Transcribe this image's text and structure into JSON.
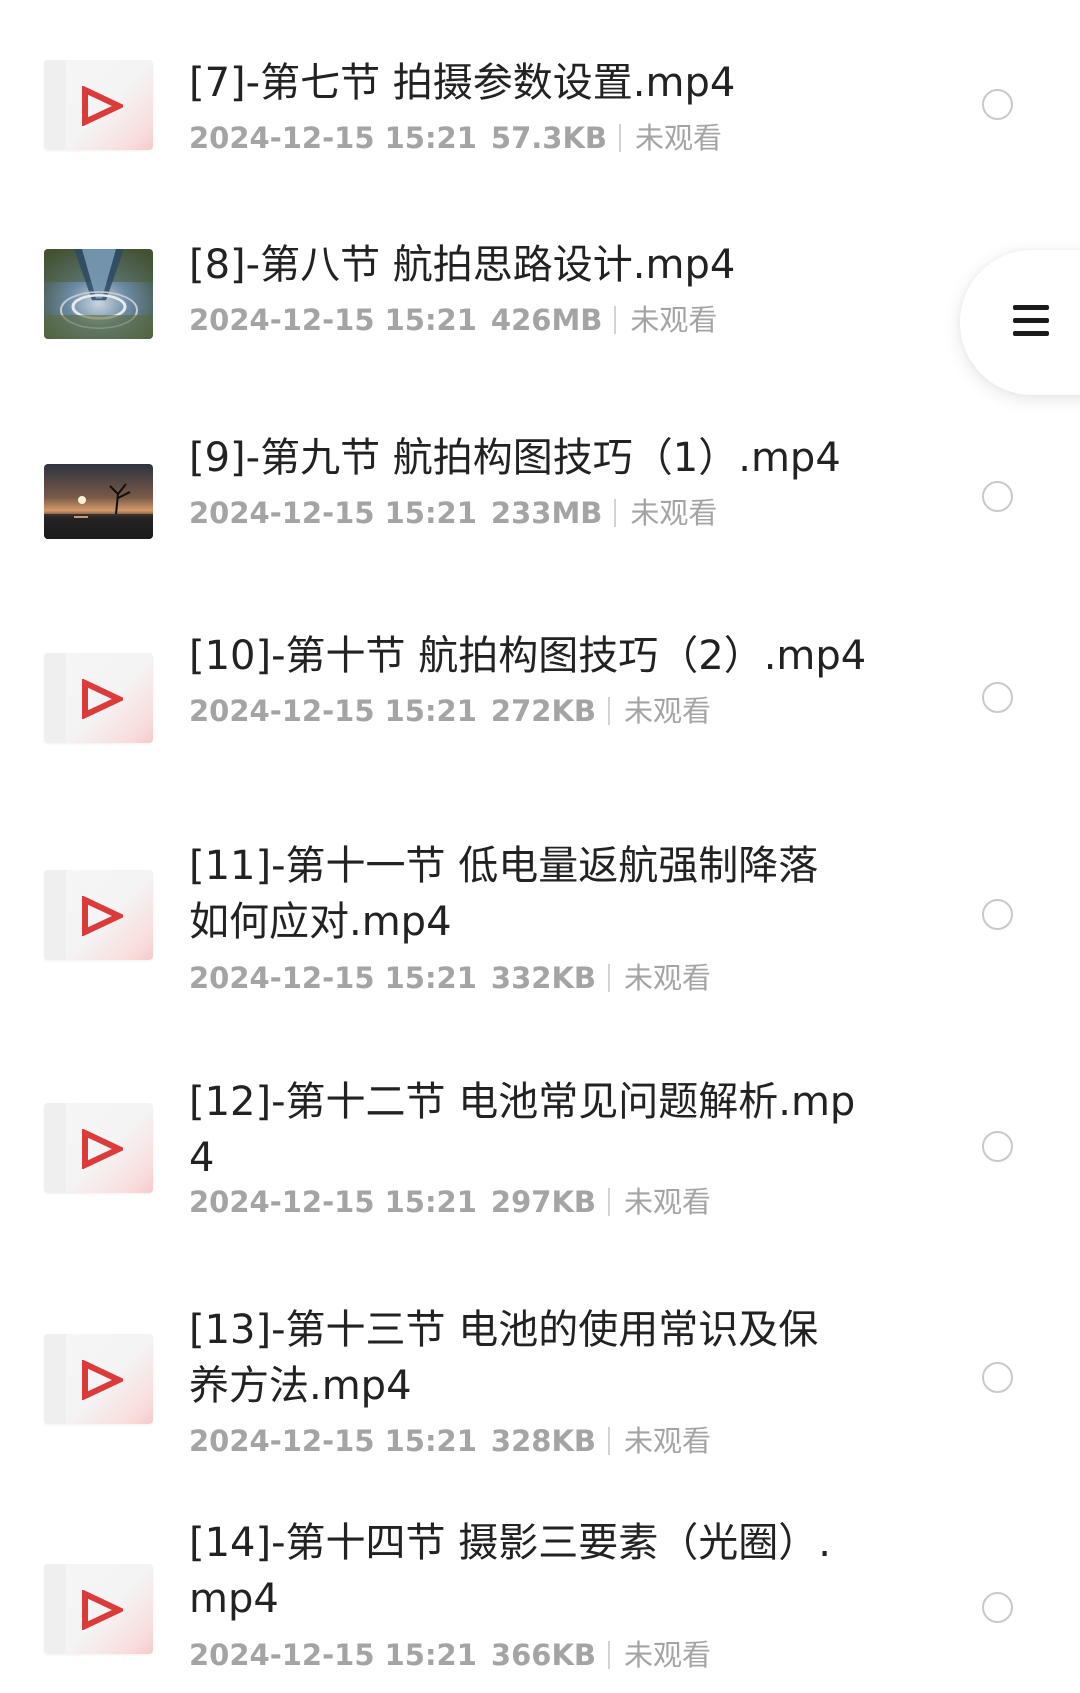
{
  "files": [
    {
      "title": "[7]-第七节 拍摄参数设置.mp4",
      "datetime": "2024-12-15 15:21",
      "size": "57.3KB",
      "status": "未观看",
      "thumbnail": "video-icon"
    },
    {
      "title": "[8]-第八节 航拍思路设计.mp4",
      "datetime": "2024-12-15 15:21",
      "size": "426MB",
      "status": "未观看",
      "thumbnail": "aerial-tower-photo"
    },
    {
      "title": "[9]-第九节 航拍构图技巧（1）.mp4",
      "datetime": "2024-12-15 15:21",
      "size": "233MB",
      "status": "未观看",
      "thumbnail": "sunset-lake-photo"
    },
    {
      "title": "[10]-第十节 航拍构图技巧（2）.mp4",
      "datetime": "2024-12-15 15:21",
      "size": "272KB",
      "status": "未观看",
      "thumbnail": "video-icon"
    },
    {
      "title_line1": "[11]-第十一节 低电量返航强制降落",
      "title_line2": "如何应对.mp4",
      "datetime": "2024-12-15 15:21",
      "size": "332KB",
      "status": "未观看",
      "thumbnail": "video-icon"
    },
    {
      "title_line1": "[12]-第十二节 电池常见问题解析.mp",
      "title_line2": "4",
      "datetime": "2024-12-15 15:21",
      "size": "297KB",
      "status": "未观看",
      "thumbnail": "video-icon"
    },
    {
      "title_line1": "[13]-第十三节 电池的使用常识及保",
      "title_line2": "养方法.mp4",
      "datetime": "2024-12-15 15:21",
      "size": "328KB",
      "status": "未观看",
      "thumbnail": "video-icon"
    },
    {
      "title_line1": "[14]-第十四节 摄影三要素（光圈）.",
      "title_line2": "mp4",
      "datetime": "2024-12-15 15:21",
      "size": "366KB",
      "status": "未观看",
      "thumbnail": "video-icon"
    }
  ],
  "floating_menu": {
    "icon": "menu-icon"
  },
  "colors": {
    "play_icon": "#dc3b3b",
    "meta_text": "#a4a4a4",
    "title_text": "#222222",
    "radio_border": "#c9c9c9"
  }
}
